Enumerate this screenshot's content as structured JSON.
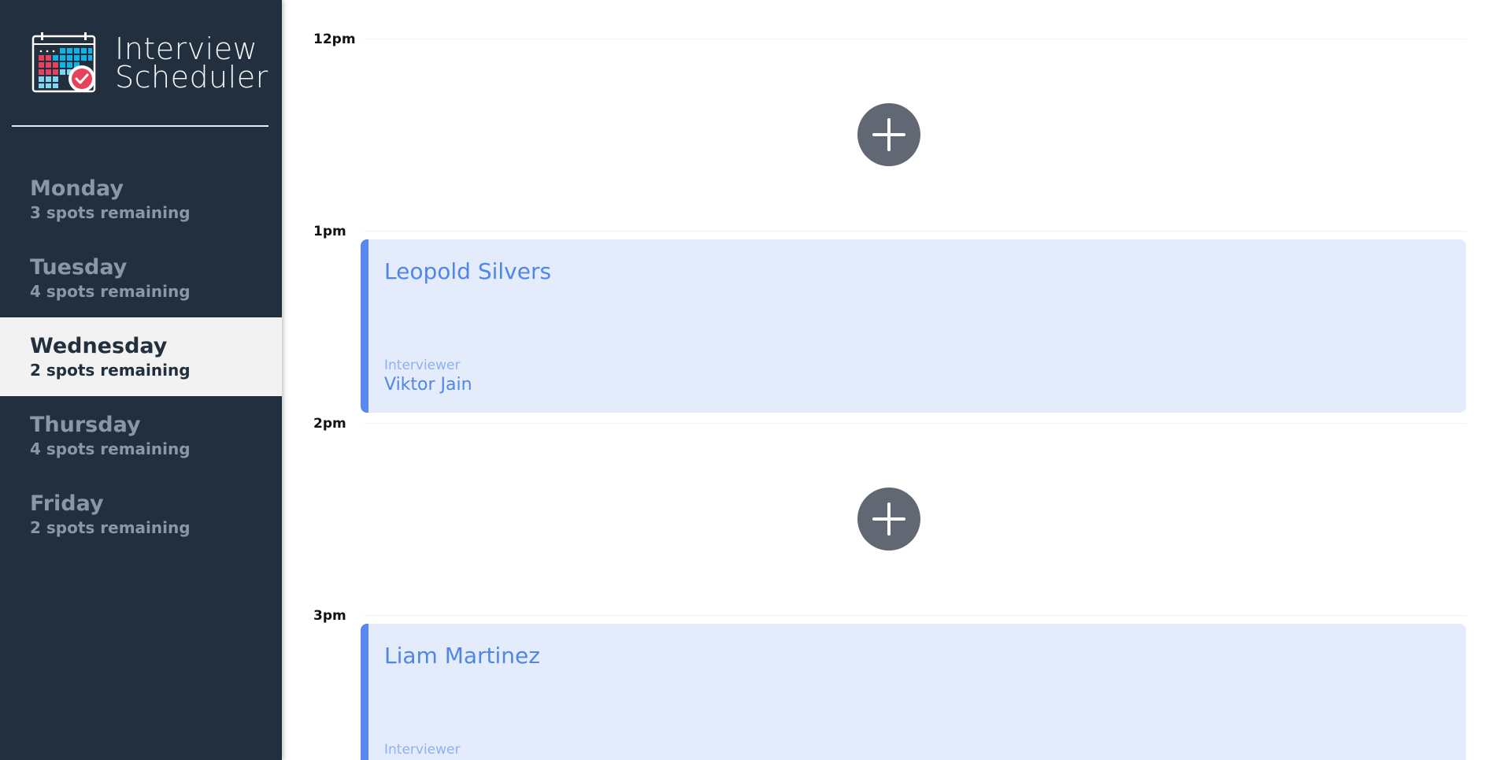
{
  "app": {
    "title_line1": "Interview",
    "title_line2": "Scheduler"
  },
  "days": [
    {
      "name": "Monday",
      "spots": "3 spots remaining",
      "selected": false
    },
    {
      "name": "Tuesday",
      "spots": "4 spots remaining",
      "selected": false
    },
    {
      "name": "Wednesday",
      "spots": "2 spots remaining",
      "selected": true
    },
    {
      "name": "Thursday",
      "spots": "4 spots remaining",
      "selected": false
    },
    {
      "name": "Friday",
      "spots": "2 spots remaining",
      "selected": false
    }
  ],
  "slots": [
    {
      "time": "12pm",
      "type": "empty",
      "add_icon": "plus-icon"
    },
    {
      "time": "1pm",
      "type": "booked",
      "student": "Leopold Silvers",
      "interviewer_label": "Interviewer",
      "interviewer": "Viktor Jain"
    },
    {
      "time": "2pm",
      "type": "empty",
      "add_icon": "plus-icon"
    },
    {
      "time": "3pm",
      "type": "booked",
      "student": "Liam Martinez",
      "interviewer_label": "Interviewer",
      "interviewer": ""
    }
  ],
  "colors": {
    "sidebar_bg": "#222f3e",
    "selected_bg": "#f2f2f2",
    "appointment_bg": "#e4ecfb",
    "appointment_accent": "#5a88ee",
    "add_button": "#626873"
  }
}
